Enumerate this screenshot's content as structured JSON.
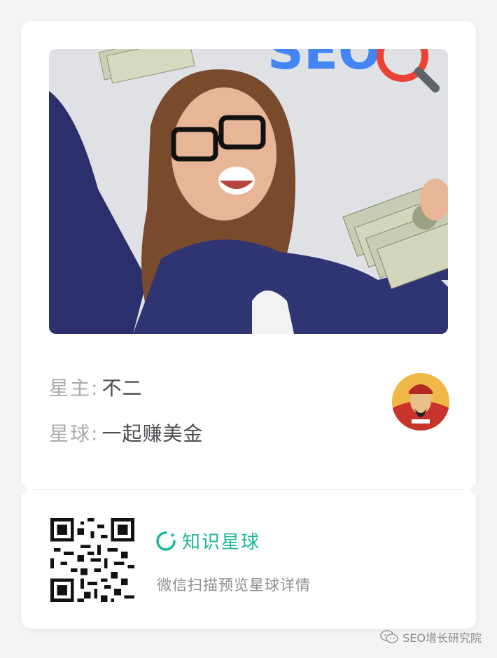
{
  "card": {
    "hero": {
      "image_description": "woman with glasses holding fanned dollar bills",
      "logo_text": "SEO",
      "magnifier_icon": "magnifier-icon"
    },
    "owner_label": "星主:",
    "owner_value": "不二",
    "planet_label": "星球:",
    "planet_value": "一起赚美金",
    "brand_name": "知识星球",
    "scan_hint": "微信扫描预览星球详情"
  },
  "footer": {
    "account_name": "SEO增长研究院",
    "icon": "wechat-icon"
  },
  "colors": {
    "brand_green": "#1fb59a",
    "page_bg": "#f4f4f5",
    "card_bg": "#ffffff",
    "label_gray": "#a9a9ae",
    "value_dark": "#4b4b50"
  }
}
